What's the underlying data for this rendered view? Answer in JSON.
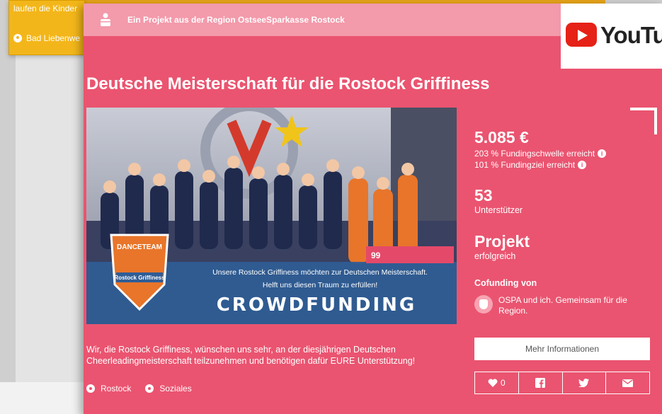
{
  "background": {
    "card_text": "laufen die Kinder",
    "card_location": "Bad Liebenwe"
  },
  "header": {
    "region_text": "Ein Projekt aus der Region OstseeSparkasse Rostock"
  },
  "project": {
    "title": "Deutsche Meisterschaft für die Rostock Griffiness",
    "image": {
      "banner_line1": "Unsere Rostock Griffiness möchten zur Deutschen Meisterschaft.",
      "banner_line2": "Helft uns diesen Traum zu erfüllen!",
      "banner_title": "CROWDFUNDING",
      "badge_number": "99",
      "logo_top": "DANCETEAM",
      "logo_bottom": "Rostock Griffiness"
    },
    "description": "Wir, die Rostock Griffiness, wünschen uns sehr, an der diesjährigen Deutschen Cheerleadingmeisterschaft teilzunehmen und benötigen dafür EURE Unterstützung!",
    "tags": [
      "Rostock",
      "Soziales"
    ]
  },
  "stats": {
    "amount": "5.085 €",
    "threshold": "203 % Fundingschwelle erreicht",
    "goal": "101 % Fundingziel erreicht",
    "supporters_count": "53",
    "supporters_label": "Unterstützer",
    "status_title": "Projekt",
    "status_value": "erfolgreich"
  },
  "cofunding": {
    "heading": "Cofunding von",
    "text": "OSPA und ich. Gemeinsam für die Region."
  },
  "actions": {
    "more_info": "Mehr Informationen",
    "likes": "0"
  },
  "youtube": {
    "label": "YouTube"
  },
  "colors": {
    "card": "#ea5470",
    "header": "#f39aab",
    "accent_bg": "#f3b61a",
    "youtube_red": "#e62117"
  },
  "icons": [
    "location-icon",
    "info-icon",
    "heart-icon",
    "facebook-icon",
    "twitter-icon",
    "email-icon",
    "sparkasse-logo-icon",
    "youtube-play-icon"
  ]
}
